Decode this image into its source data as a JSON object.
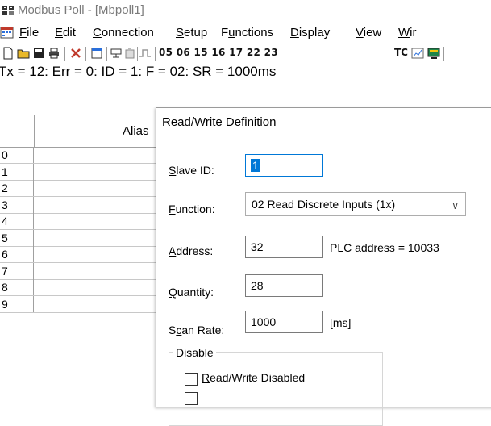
{
  "window": {
    "title": "Modbus Poll - [Mbpoll1]"
  },
  "menu": {
    "items": [
      {
        "label": "File"
      },
      {
        "label": "Edit"
      },
      {
        "label": "Connection"
      },
      {
        "label": "Setup"
      },
      {
        "label": "Functions"
      },
      {
        "label": "Display"
      },
      {
        "label": "View"
      },
      {
        "label": "Wir"
      }
    ]
  },
  "toolbar": {
    "function_codes": "05 06 15 16 17 22 23",
    "tc_label": "TC"
  },
  "status_line": "Tx = 12: Err = 0: ID = 1: F = 02: SR = 1000ms",
  "grid": {
    "alias_header": "Alias",
    "rows": [
      "0",
      "1",
      "2",
      "3",
      "4",
      "5",
      "6",
      "7",
      "8",
      "9"
    ]
  },
  "dialog": {
    "title": "Read/Write Definition",
    "slave_id_label": "Slave ID:",
    "slave_id_value": "1",
    "function_label": "Function:",
    "function_value": "02 Read Discrete Inputs (1x)",
    "address_label": "Address:",
    "address_value": "32",
    "plc_address_text": "PLC address = 10033",
    "quantity_label": "Quantity:",
    "quantity_value": "28",
    "scan_rate_label": "Scan Rate:",
    "scan_rate_value": "1000",
    "scan_rate_unit": "[ms]",
    "disable_group_label": "Disable",
    "rw_disabled_label": "Read/Write Disabled",
    "rw_disabled_checked": false
  }
}
